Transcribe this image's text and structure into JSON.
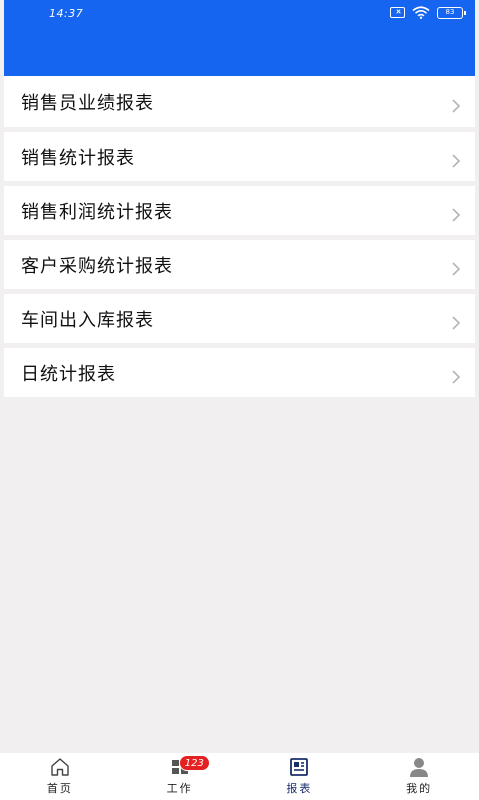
{
  "status_bar": {
    "time": "14:37",
    "battery": "83"
  },
  "menu": {
    "items": [
      {
        "label": "销售员业绩报表"
      },
      {
        "label": "销售统计报表"
      },
      {
        "label": "销售利润统计报表"
      },
      {
        "label": "客户采购统计报表"
      },
      {
        "label": "车间出入库报表"
      },
      {
        "label": "日统计报表"
      }
    ]
  },
  "tabbar": {
    "tabs": [
      {
        "label": "首页",
        "icon": "home-icon"
      },
      {
        "label": "工作",
        "icon": "grid-icon",
        "badge": "123"
      },
      {
        "label": "报表",
        "icon": "report-icon",
        "active": true
      },
      {
        "label": "我的",
        "icon": "user-icon"
      }
    ]
  },
  "colors": {
    "header": "#1665f0",
    "background": "#f1eff0",
    "active_tab": "#1a2e6e",
    "badge": "#e52020"
  }
}
